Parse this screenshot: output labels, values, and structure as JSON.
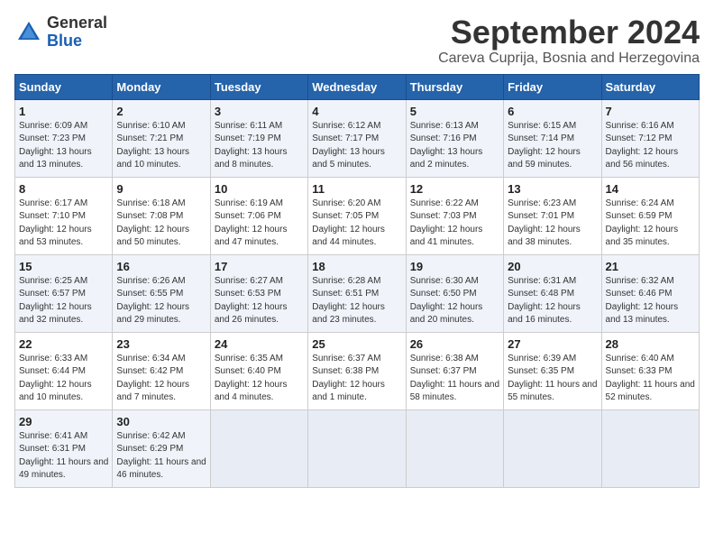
{
  "logo": {
    "general": "General",
    "blue": "Blue"
  },
  "title": "September 2024",
  "location": "Careva Cuprija, Bosnia and Herzegovina",
  "headers": [
    "Sunday",
    "Monday",
    "Tuesday",
    "Wednesday",
    "Thursday",
    "Friday",
    "Saturday"
  ],
  "weeks": [
    [
      {
        "day": "1",
        "sunrise": "6:09 AM",
        "sunset": "7:23 PM",
        "daylight": "13 hours and 13 minutes."
      },
      {
        "day": "2",
        "sunrise": "6:10 AM",
        "sunset": "7:21 PM",
        "daylight": "13 hours and 10 minutes."
      },
      {
        "day": "3",
        "sunrise": "6:11 AM",
        "sunset": "7:19 PM",
        "daylight": "13 hours and 8 minutes."
      },
      {
        "day": "4",
        "sunrise": "6:12 AM",
        "sunset": "7:17 PM",
        "daylight": "13 hours and 5 minutes."
      },
      {
        "day": "5",
        "sunrise": "6:13 AM",
        "sunset": "7:16 PM",
        "daylight": "13 hours and 2 minutes."
      },
      {
        "day": "6",
        "sunrise": "6:15 AM",
        "sunset": "7:14 PM",
        "daylight": "12 hours and 59 minutes."
      },
      {
        "day": "7",
        "sunrise": "6:16 AM",
        "sunset": "7:12 PM",
        "daylight": "12 hours and 56 minutes."
      }
    ],
    [
      {
        "day": "8",
        "sunrise": "6:17 AM",
        "sunset": "7:10 PM",
        "daylight": "12 hours and 53 minutes."
      },
      {
        "day": "9",
        "sunrise": "6:18 AM",
        "sunset": "7:08 PM",
        "daylight": "12 hours and 50 minutes."
      },
      {
        "day": "10",
        "sunrise": "6:19 AM",
        "sunset": "7:06 PM",
        "daylight": "12 hours and 47 minutes."
      },
      {
        "day": "11",
        "sunrise": "6:20 AM",
        "sunset": "7:05 PM",
        "daylight": "12 hours and 44 minutes."
      },
      {
        "day": "12",
        "sunrise": "6:22 AM",
        "sunset": "7:03 PM",
        "daylight": "12 hours and 41 minutes."
      },
      {
        "day": "13",
        "sunrise": "6:23 AM",
        "sunset": "7:01 PM",
        "daylight": "12 hours and 38 minutes."
      },
      {
        "day": "14",
        "sunrise": "6:24 AM",
        "sunset": "6:59 PM",
        "daylight": "12 hours and 35 minutes."
      }
    ],
    [
      {
        "day": "15",
        "sunrise": "6:25 AM",
        "sunset": "6:57 PM",
        "daylight": "12 hours and 32 minutes."
      },
      {
        "day": "16",
        "sunrise": "6:26 AM",
        "sunset": "6:55 PM",
        "daylight": "12 hours and 29 minutes."
      },
      {
        "day": "17",
        "sunrise": "6:27 AM",
        "sunset": "6:53 PM",
        "daylight": "12 hours and 26 minutes."
      },
      {
        "day": "18",
        "sunrise": "6:28 AM",
        "sunset": "6:51 PM",
        "daylight": "12 hours and 23 minutes."
      },
      {
        "day": "19",
        "sunrise": "6:30 AM",
        "sunset": "6:50 PM",
        "daylight": "12 hours and 20 minutes."
      },
      {
        "day": "20",
        "sunrise": "6:31 AM",
        "sunset": "6:48 PM",
        "daylight": "12 hours and 16 minutes."
      },
      {
        "day": "21",
        "sunrise": "6:32 AM",
        "sunset": "6:46 PM",
        "daylight": "12 hours and 13 minutes."
      }
    ],
    [
      {
        "day": "22",
        "sunrise": "6:33 AM",
        "sunset": "6:44 PM",
        "daylight": "12 hours and 10 minutes."
      },
      {
        "day": "23",
        "sunrise": "6:34 AM",
        "sunset": "6:42 PM",
        "daylight": "12 hours and 7 minutes."
      },
      {
        "day": "24",
        "sunrise": "6:35 AM",
        "sunset": "6:40 PM",
        "daylight": "12 hours and 4 minutes."
      },
      {
        "day": "25",
        "sunrise": "6:37 AM",
        "sunset": "6:38 PM",
        "daylight": "12 hours and 1 minute."
      },
      {
        "day": "26",
        "sunrise": "6:38 AM",
        "sunset": "6:37 PM",
        "daylight": "11 hours and 58 minutes."
      },
      {
        "day": "27",
        "sunrise": "6:39 AM",
        "sunset": "6:35 PM",
        "daylight": "11 hours and 55 minutes."
      },
      {
        "day": "28",
        "sunrise": "6:40 AM",
        "sunset": "6:33 PM",
        "daylight": "11 hours and 52 minutes."
      }
    ],
    [
      {
        "day": "29",
        "sunrise": "6:41 AM",
        "sunset": "6:31 PM",
        "daylight": "11 hours and 49 minutes."
      },
      {
        "day": "30",
        "sunrise": "6:42 AM",
        "sunset": "6:29 PM",
        "daylight": "11 hours and 46 minutes."
      },
      null,
      null,
      null,
      null,
      null
    ]
  ]
}
